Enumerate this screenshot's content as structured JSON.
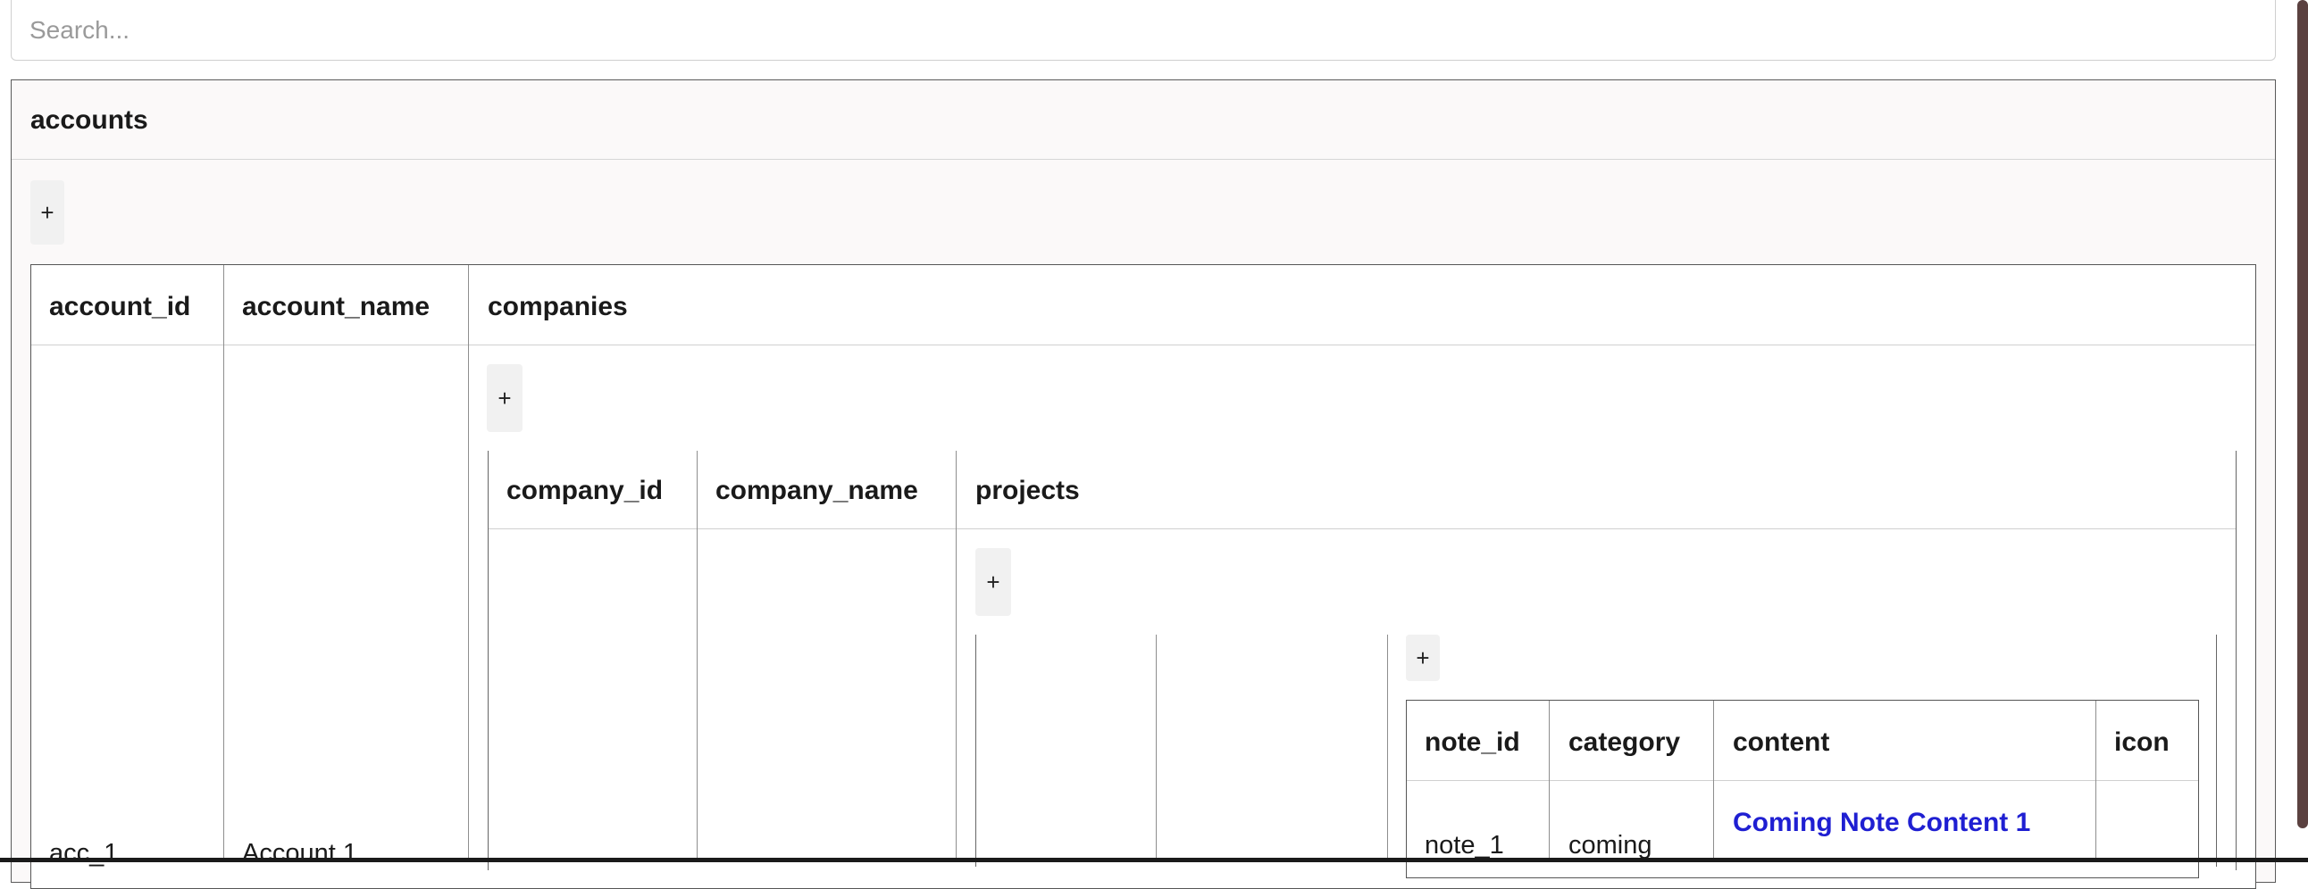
{
  "search": {
    "placeholder": "Search..."
  },
  "accounts": {
    "title": "accounts",
    "add_label": "+",
    "columns": [
      "account_id",
      "account_name",
      "companies"
    ],
    "rows": [
      {
        "account_id": "acc_1",
        "account_name": "Account 1"
      }
    ]
  },
  "companies": {
    "add_label": "+",
    "columns": [
      "company_id",
      "company_name",
      "projects"
    ]
  },
  "projects": {
    "add_label": "+"
  },
  "notes": {
    "add_label": "+",
    "columns": [
      "note_id",
      "category",
      "content",
      "icon"
    ],
    "rows": [
      {
        "note_id": "note_1",
        "category": "coming",
        "content": "Coming Note Content 1",
        "icon": ""
      }
    ]
  },
  "colors": {
    "link": "#1f1fd2",
    "scrollbar": "#5b4140",
    "panel_bg": "#fbf9f9"
  }
}
